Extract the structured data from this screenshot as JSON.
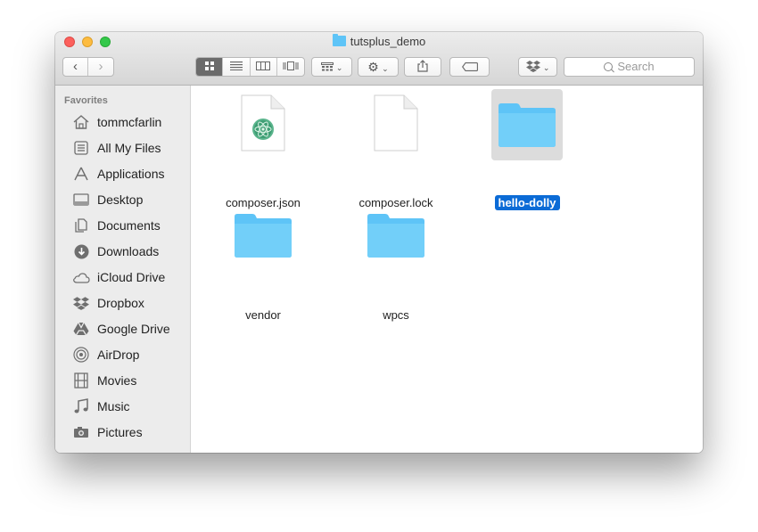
{
  "window": {
    "title": "tutsplus_demo"
  },
  "toolbar": {
    "back_icon": "chevron-left-icon",
    "forward_icon": "chevron-right-icon",
    "view_icons": [
      "icon-view",
      "list-view",
      "column-view",
      "cover-flow-view"
    ],
    "active_view": "icon-view",
    "arrange_icon": "arrange-icon",
    "action_icon": "gear-icon",
    "share_icon": "share-icon",
    "tag_icon": "tag-icon",
    "dropbox_icon": "dropbox-icon"
  },
  "search": {
    "placeholder": "Search"
  },
  "sidebar": {
    "header": "Favorites",
    "items": [
      {
        "label": "tommcfarlin",
        "icon": "home-icon"
      },
      {
        "label": "All My Files",
        "icon": "all-files-icon"
      },
      {
        "label": "Applications",
        "icon": "applications-icon"
      },
      {
        "label": "Desktop",
        "icon": "desktop-icon"
      },
      {
        "label": "Documents",
        "icon": "documents-icon"
      },
      {
        "label": "Downloads",
        "icon": "downloads-icon"
      },
      {
        "label": "iCloud Drive",
        "icon": "cloud-icon"
      },
      {
        "label": "Dropbox",
        "icon": "dropbox-icon"
      },
      {
        "label": "Google Drive",
        "icon": "google-drive-icon"
      },
      {
        "label": "AirDrop",
        "icon": "airdrop-icon"
      },
      {
        "label": "Movies",
        "icon": "movies-icon"
      },
      {
        "label": "Music",
        "icon": "music-icon"
      },
      {
        "label": "Pictures",
        "icon": "pictures-icon"
      }
    ]
  },
  "files": [
    {
      "name": "composer.json",
      "kind": "json-file",
      "selected": false
    },
    {
      "name": "composer.lock",
      "kind": "document-file",
      "selected": false
    },
    {
      "name": "hello-dolly",
      "kind": "folder",
      "selected": true
    },
    {
      "name": "vendor",
      "kind": "folder",
      "selected": false
    },
    {
      "name": "wpcs",
      "kind": "folder",
      "selected": false
    }
  ],
  "colors": {
    "folder": "#5ec4f7",
    "selection": "#0b6bd6",
    "sidebar_bg": "#ececec"
  }
}
